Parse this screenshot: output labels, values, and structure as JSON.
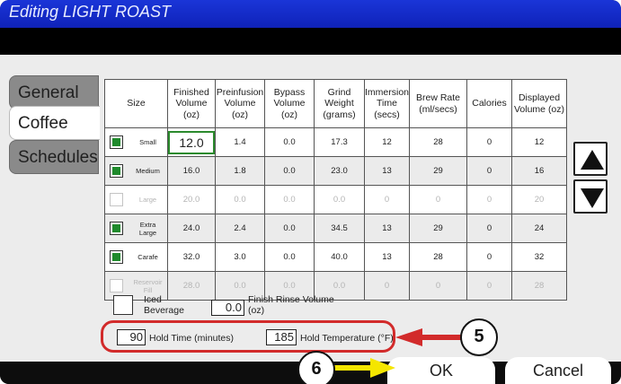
{
  "window": {
    "title": "Editing LIGHT ROAST"
  },
  "tabs": [
    {
      "label": "General",
      "active": false
    },
    {
      "label": "Coffee",
      "active": true
    },
    {
      "label": "Schedules",
      "active": false
    }
  ],
  "table": {
    "headers": [
      "Size",
      "Finished Volume (oz)",
      "Preinfusion Volume (oz)",
      "Bypass Volume (oz)",
      "Grind Weight (grams)",
      "Immersion Time (secs)",
      "Brew Rate (ml/secs)",
      "Calories",
      "Displayed Volume (oz)"
    ],
    "rows": [
      {
        "size": "Small",
        "checked": true,
        "enabled": true,
        "values": [
          "12.0",
          "1.4",
          "0.0",
          "17.3",
          "12",
          "28",
          "0",
          "12"
        ]
      },
      {
        "size": "Medium",
        "checked": true,
        "enabled": true,
        "values": [
          "16.0",
          "1.8",
          "0.0",
          "23.0",
          "13",
          "29",
          "0",
          "16"
        ]
      },
      {
        "size": "Large",
        "checked": false,
        "enabled": false,
        "values": [
          "20.0",
          "0.0",
          "0.0",
          "0.0",
          "0",
          "0",
          "0",
          "20"
        ]
      },
      {
        "size": "Extra Large",
        "checked": true,
        "enabled": true,
        "values": [
          "24.0",
          "2.4",
          "0.0",
          "34.5",
          "13",
          "29",
          "0",
          "24"
        ]
      },
      {
        "size": "Carafe",
        "checked": true,
        "enabled": true,
        "values": [
          "32.0",
          "3.0",
          "0.0",
          "40.0",
          "13",
          "28",
          "0",
          "32"
        ]
      },
      {
        "size": "Reservoir Fill",
        "checked": false,
        "enabled": false,
        "values": [
          "28.0",
          "0.0",
          "0.0",
          "0.0",
          "0",
          "0",
          "0",
          "28"
        ]
      }
    ]
  },
  "options": {
    "iced_label": "Iced Beverage",
    "iced_checked": false,
    "rinse_value": "0.0",
    "rinse_label": "Finish Rinse Volume (oz)",
    "hold_time_value": "90",
    "hold_time_label": "Hold Time (minutes)",
    "hold_temp_value": "185",
    "hold_temp_label": "Hold Temperature (°F)"
  },
  "buttons": {
    "ok": "OK",
    "cancel": "Cancel"
  },
  "callouts": {
    "step5": "5",
    "step6": "6"
  },
  "colors": {
    "titlebar": "#1a35d8",
    "checked": "#1f8a2c",
    "highlight_red": "#d22b2b",
    "arrow_yellow": "#f5e600"
  },
  "icons": {
    "scroll_up": "triangle-up-icon",
    "scroll_down": "triangle-down-icon"
  }
}
